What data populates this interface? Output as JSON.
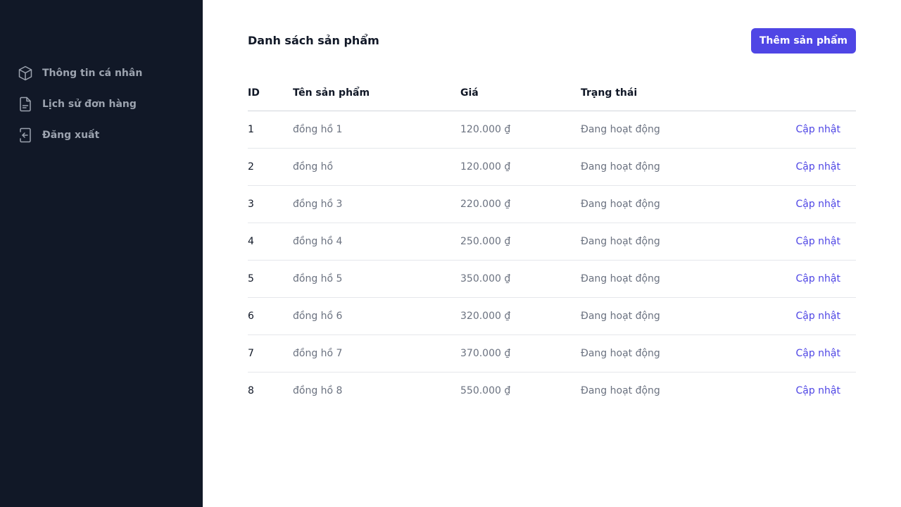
{
  "sidebar": {
    "items": [
      {
        "label": "Thông tin cá nhân",
        "icon": "cube-icon"
      },
      {
        "label": "Lịch sử đơn hàng",
        "icon": "document-icon"
      },
      {
        "label": "Đăng xuất",
        "icon": "logout-icon"
      }
    ]
  },
  "header": {
    "title": "Danh sách sản phẩm",
    "add_button_label": "Thêm sản phẩm"
  },
  "table": {
    "columns": [
      "ID",
      "Tên sản phẩm",
      "Giá",
      "Trạng thái",
      ""
    ],
    "rows": [
      {
        "id": "1",
        "name": "đồng hồ 1",
        "price": "120.000 ₫",
        "status": "Đang hoạt động",
        "action": "Cập nhật"
      },
      {
        "id": "2",
        "name": "đồng hồ",
        "price": "120.000 ₫",
        "status": "Đang hoạt động",
        "action": "Cập nhật"
      },
      {
        "id": "3",
        "name": "đồng hồ 3",
        "price": "220.000 ₫",
        "status": "Đang hoạt động",
        "action": "Cập nhật"
      },
      {
        "id": "4",
        "name": "đồng hồ 4",
        "price": "250.000 ₫",
        "status": "Đang hoạt động",
        "action": "Cập nhật"
      },
      {
        "id": "5",
        "name": "đồng hồ 5",
        "price": "350.000 ₫",
        "status": "Đang hoạt động",
        "action": "Cập nhật"
      },
      {
        "id": "6",
        "name": "đồng hồ 6",
        "price": "320.000 ₫",
        "status": "Đang hoạt động",
        "action": "Cập nhật"
      },
      {
        "id": "7",
        "name": "đồng hồ 7",
        "price": "370.000 ₫",
        "status": "Đang hoạt động",
        "action": "Cập nhật"
      },
      {
        "id": "8",
        "name": "đồng hồ 8",
        "price": "550.000 ₫",
        "status": "Đang hoạt động",
        "action": "Cập nhật"
      }
    ]
  },
  "colors": {
    "sidebar_bg": "#111827",
    "accent": "#4f46e5",
    "muted_text": "#6b7280",
    "nav_text": "#9ca3af"
  }
}
